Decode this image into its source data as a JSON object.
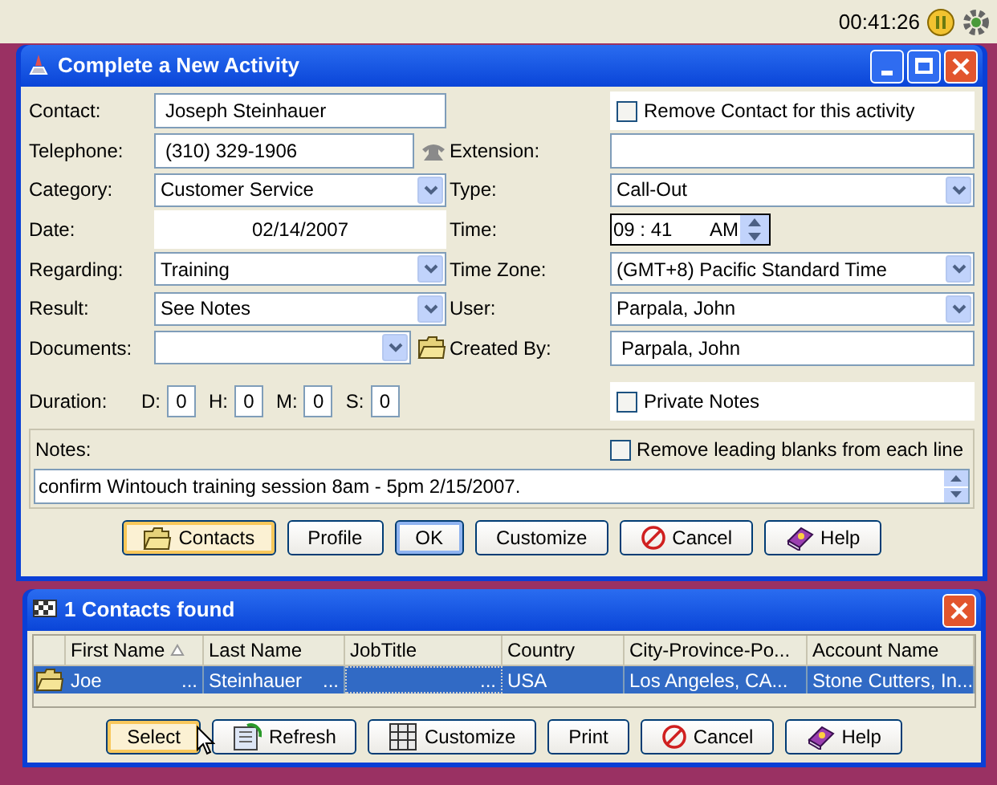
{
  "top_bar": {
    "clock": "00:41:26"
  },
  "activity_window": {
    "title": "Complete a New Activity",
    "rows": [
      {
        "left": {
          "label": "Contact:",
          "kind": "text",
          "value": "Joseph Steinhauer"
        },
        "right": {
          "kind": "checkbox",
          "text": "Remove Contact for this activity",
          "checked": false
        }
      },
      {
        "left": {
          "label": "Telephone:",
          "kind": "phone",
          "value": "(310) 329-1906"
        },
        "right": {
          "label": "Extension:",
          "kind": "text"
        }
      },
      {
        "left": {
          "label": "Category:",
          "kind": "dropdown",
          "value": "Customer Service"
        },
        "right": {
          "label": "Type:",
          "kind": "dropdown",
          "value": "Call-Out"
        }
      },
      {
        "left": {
          "label": "Date:",
          "kind": "date",
          "value": "02/14/2007"
        },
        "right": {
          "label": "Time:",
          "kind": "time",
          "hour": "09",
          "separator": ":",
          "minute": "41",
          "ampm": "AM"
        }
      },
      {
        "left": {
          "label": "Regarding:",
          "kind": "dropdown",
          "value": "Training"
        },
        "right": {
          "label": "Time Zone:",
          "kind": "dropdown",
          "value": "(GMT+8) Pacific Standard Time"
        }
      },
      {
        "left": {
          "label": "Result:",
          "kind": "dropdown",
          "value": "See Notes"
        },
        "right": {
          "label": "User:",
          "kind": "dropdown",
          "value": "Parpala, John"
        }
      },
      {
        "left": {
          "label": "Documents:",
          "kind": "document_picker"
        },
        "right": {
          "label": "Created By:",
          "kind": "text",
          "value": "Parpala, John"
        }
      }
    ],
    "duration": {
      "label": "Duration:",
      "parts": [
        {
          "label": "D:",
          "value": "0"
        },
        {
          "label": "H:",
          "value": "0"
        },
        {
          "label": "M:",
          "value": "0"
        },
        {
          "label": "S:",
          "value": "0"
        }
      ]
    },
    "private_notes": {
      "text": "Private Notes",
      "checked": false
    },
    "notes": {
      "label": "Notes:",
      "remove_blanks": {
        "text": "Remove leading blanks from each line",
        "checked": false
      },
      "value": "confirm Wintouch training session 8am - 5pm 2/15/2007."
    },
    "buttons": [
      {
        "label": "Contacts",
        "kind": "folder",
        "highlighted": true
      },
      {
        "label": "Profile"
      },
      {
        "label": "OK",
        "focused": true
      },
      {
        "label": "Customize"
      },
      {
        "label": "Cancel",
        "kind": "cancel"
      },
      {
        "label": "Help",
        "kind": "book"
      }
    ]
  },
  "contacts_window": {
    "title": "1 Contacts found",
    "columns": [
      {
        "label": "First Name",
        "sorted": true
      },
      {
        "label": "Last Name"
      },
      {
        "label": "JobTitle"
      },
      {
        "label": "Country"
      },
      {
        "label": "City-Province-Po..."
      },
      {
        "label": "Account Name"
      }
    ],
    "rows": [
      {
        "selected": true,
        "cells": [
          {
            "text": "Joe",
            "overflow": "..."
          },
          {
            "text": "Steinhauer",
            "overflow": "..."
          },
          {
            "overflow": "..."
          },
          {
            "text": "USA"
          },
          {
            "text": "Los Angeles, CA..."
          },
          {
            "text": "Stone Cutters, In..."
          }
        ]
      }
    ],
    "buttons": [
      {
        "label": "Select",
        "highlighted": true
      },
      {
        "label": "Refresh",
        "kind": "refresh"
      },
      {
        "label": "Customize",
        "kind": "columns"
      },
      {
        "label": "Print"
      },
      {
        "label": "Cancel",
        "kind": "cancel"
      },
      {
        "label": "Help",
        "kind": "book"
      }
    ]
  }
}
